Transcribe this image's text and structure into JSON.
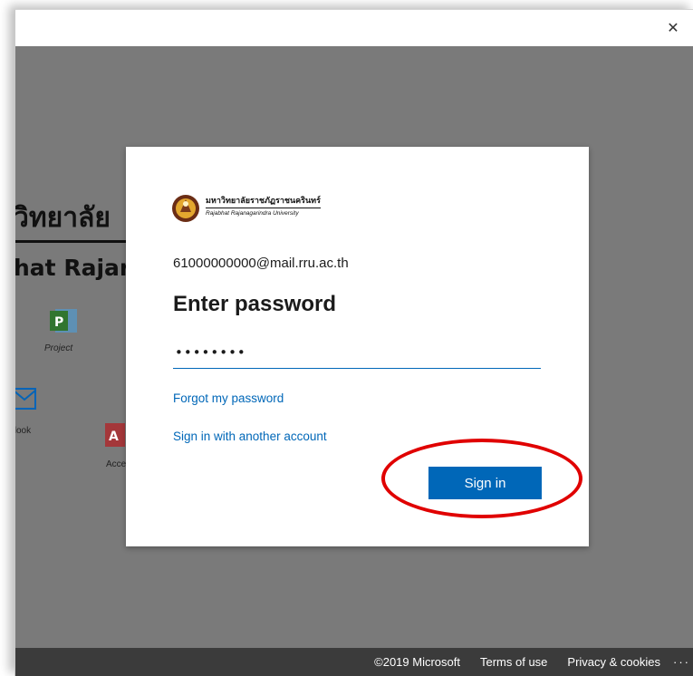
{
  "titlebar": {
    "close_icon": "close-icon",
    "close_glyph": "✕"
  },
  "background": {
    "thai_text": "วิทยาลัย",
    "latin_text": "hat Rajar",
    "apps": [
      {
        "name": "Project",
        "icon_letter": "P",
        "color": "#31752f"
      },
      {
        "name": "tlook",
        "icon_letter": "",
        "color": "#0364b8"
      },
      {
        "name": "Acce",
        "icon_letter": "A",
        "color": "#a4373a"
      }
    ]
  },
  "card": {
    "logo": {
      "thai_name": "มหาวิทยาลัยราชภัฏราชนครินทร์",
      "english_name": "Rajabhat Rajanagarindra University"
    },
    "email": "61000000000@mail.rru.ac.th",
    "heading": "Enter password",
    "password_value": "••••••••",
    "forgot_link": "Forgot my password",
    "other_account_link": "Sign in with another account",
    "signin_label": "Sign in"
  },
  "footer": {
    "copyright": "©2019 Microsoft",
    "terms": "Terms of use",
    "privacy": "Privacy & cookies",
    "more": "···"
  },
  "colors": {
    "accent": "#0067b8",
    "highlight": "#e00000",
    "backdrop": "#7a7a7a",
    "footer": "#3b3b3b"
  }
}
